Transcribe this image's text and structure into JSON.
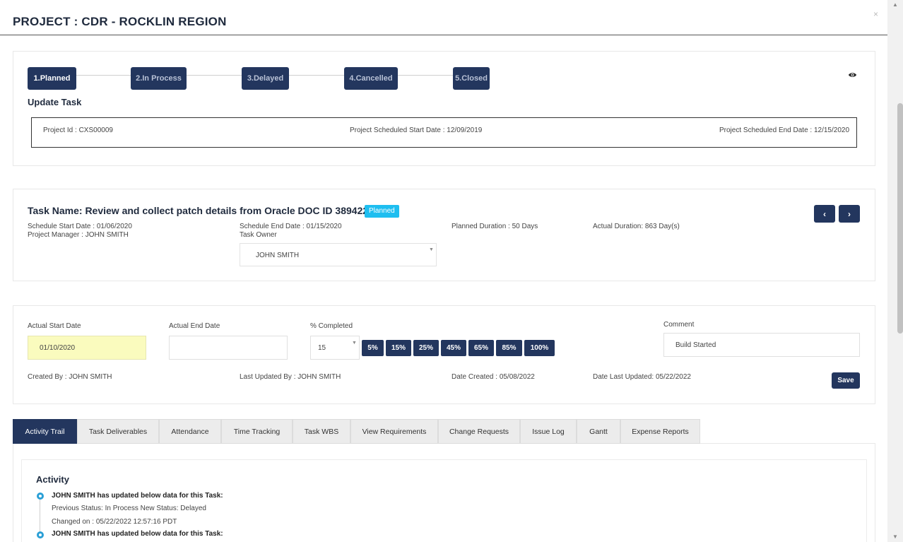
{
  "header": {
    "title": "PROJECT : CDR - ROCKLIN REGION",
    "close_label": "×"
  },
  "stepper": {
    "steps": [
      "1.Planned",
      "2.In Process",
      "3.Delayed",
      "4.Cancelled",
      "5.Closed"
    ],
    "active_index": 0,
    "eye_icon": "eye-icon"
  },
  "update_task": {
    "title": "Update Task",
    "project_id": "Project Id : CXS00009",
    "project_start": "Project Scheduled Start Date : 12/09/2019",
    "project_end": "Project Scheduled End Date : 12/15/2020"
  },
  "task": {
    "name": "Task Name: Review and collect patch details from Oracle DOC ID 389422.1",
    "status_badge": "Planned",
    "schedule_start": "Schedule Start Date : 01/06/2020",
    "project_manager": "Project Manager : JOHN SMITH",
    "schedule_end": "Schedule End Date : 01/15/2020",
    "task_owner_label": "Task Owner",
    "task_owner_value": "JOHN SMITH",
    "planned_duration": "Planned Duration : 50 Days",
    "actual_duration": "Actual Duration: 863 Day(s)",
    "prev_icon": "chevron-left-icon",
    "next_icon": "chevron-right-icon",
    "prev_glyph": "‹",
    "next_glyph": "›"
  },
  "progress": {
    "actual_start_label": "Actual Start Date",
    "actual_start_value": "01/10/2020",
    "actual_end_label": "Actual End Date",
    "actual_end_value": "",
    "pct_label": "% Completed",
    "pct_value": "15",
    "pct_buttons": [
      "5%",
      "15%",
      "25%",
      "45%",
      "65%",
      "85%",
      "100%"
    ],
    "comment_label": "Comment",
    "comment_value": "Build Started",
    "created_by": "Created By : JOHN SMITH",
    "last_updated_by": "Last Updated By : JOHN SMITH",
    "date_created": "Date Created : 05/08/2022",
    "date_last_updated": "Date Last Updated: 05/22/2022",
    "save_label": "Save"
  },
  "tabs": [
    "Activity Trail",
    "Task Deliverables",
    "Attendance",
    "Time Tracking",
    "Task WBS",
    "View Requirements",
    "Change Requests",
    "Issue Log",
    "Gantt",
    "Expense Reports"
  ],
  "active_tab": 0,
  "activity": {
    "title": "Activity",
    "entries": [
      {
        "head": "JOHN SMITH has updated below data for this Task:",
        "line1": "Previous Status: In Process    New Status: Delayed",
        "line2": "Changed on : 05/22/2022 12:57:16 PDT"
      },
      {
        "head": "JOHN SMITH has updated below data for this Task:"
      }
    ]
  },
  "colors": {
    "primary": "#23365e",
    "badge": "#1ebef0",
    "highlight": "#fafbbe",
    "timeline_dot": "#2a9fd6"
  }
}
